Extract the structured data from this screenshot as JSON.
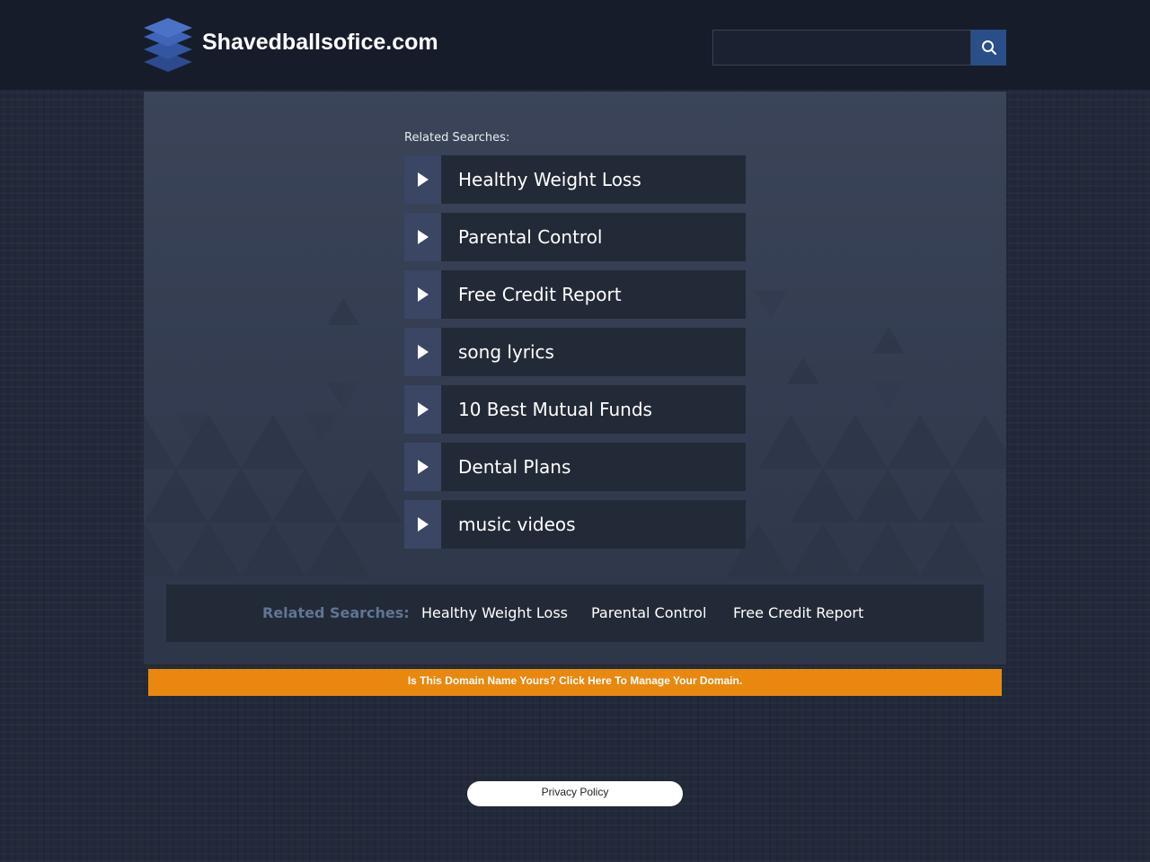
{
  "header": {
    "site_name": "Shavedballsofice.com",
    "logo_icon": "stacked-layers-icon",
    "search": {
      "value": "",
      "placeholder": "",
      "button_icon": "magnifier-icon"
    }
  },
  "main": {
    "related_label": "Related Searches:",
    "links": [
      {
        "label": "Healthy Weight Loss"
      },
      {
        "label": "Parental Control"
      },
      {
        "label": "Free Credit Report"
      },
      {
        "label": "song lyrics"
      },
      {
        "label": "10 Best Mutual Funds"
      },
      {
        "label": "Dental Plans"
      },
      {
        "label": "music videos"
      }
    ],
    "link_arrow_icon": "play-arrow-icon"
  },
  "bottom_bar": {
    "label": "Related Searches:",
    "links": [
      "Healthy Weight Loss",
      "Parental Control",
      "Free Credit Report"
    ]
  },
  "domain_banner": "Is This Domain Name Yours? Click Here To Manage Your Domain.",
  "footer": {
    "privacy_label": "Privacy Policy"
  },
  "colors": {
    "header_bg": "#161c29",
    "page_bg": "#22293a",
    "panel_bg": "#3b4458",
    "link_bg": "#232a37",
    "arrow_box_bg": "#3a4664",
    "search_button_bg": "#2a4f88",
    "banner_bg": "#e8880f",
    "bottom_label": "#5f7594"
  }
}
